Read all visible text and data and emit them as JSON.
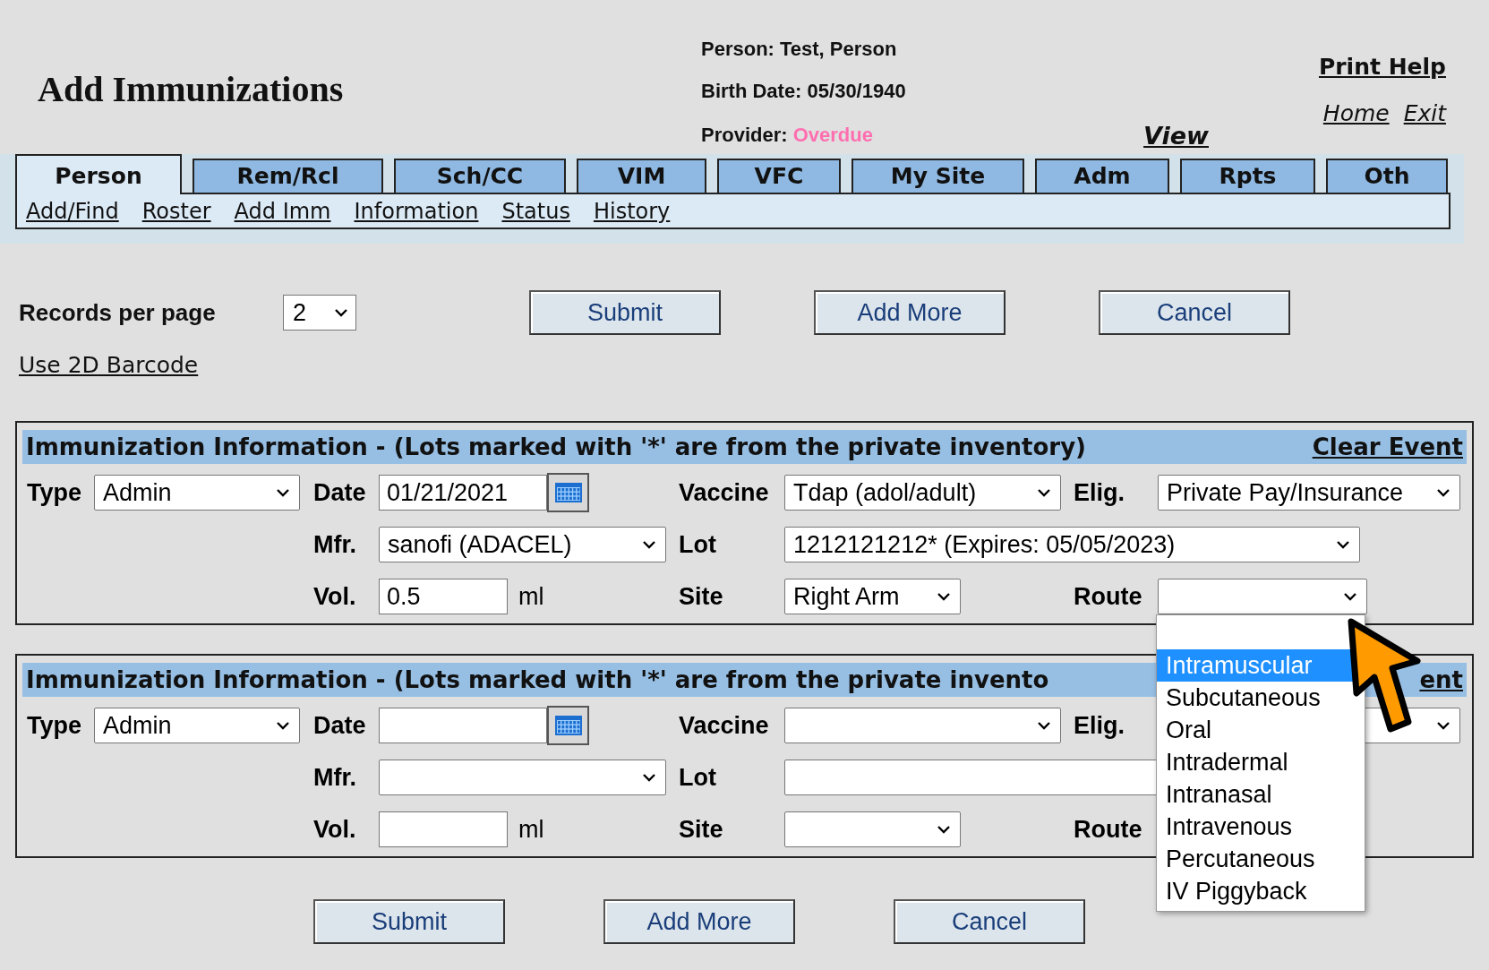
{
  "page_title": "Add Immunizations",
  "person_info": {
    "person": "Person: Test, Person",
    "birth_date": "Birth Date: 05/30/1940",
    "provider_label": "Provider:",
    "provider_value": "Overdue",
    "view_link": "View"
  },
  "top_links": {
    "print_help": "Print Help",
    "home": "Home",
    "exit": "Exit"
  },
  "tabs": [
    {
      "label": "Person",
      "selected": true
    },
    {
      "label": "Rem/Rcl",
      "selected": false
    },
    {
      "label": "Sch/CC",
      "selected": false
    },
    {
      "label": "VIM",
      "selected": false
    },
    {
      "label": "VFC",
      "selected": false
    },
    {
      "label": "My Site",
      "selected": false
    },
    {
      "label": "Adm",
      "selected": false
    },
    {
      "label": "Rpts",
      "selected": false
    },
    {
      "label": "Oth",
      "selected": false
    }
  ],
  "sub_links": [
    "Add/Find",
    "Roster",
    "Add Imm",
    "Information",
    "Status",
    "History"
  ],
  "records_per_page": {
    "label": "Records per page",
    "value": "2"
  },
  "top_buttons": [
    "Submit",
    "Add More",
    "Cancel"
  ],
  "barcode_link": "Use 2D Barcode",
  "panels": [
    {
      "title": "Immunization Information - (Lots marked with '*' are from the private inventory)",
      "clear_event": "Clear Event",
      "labels": {
        "type": "Type",
        "date": "Date",
        "vaccine": "Vaccine",
        "elig": "Elig.",
        "mfr": "Mfr.",
        "lot": "Lot",
        "vol": "Vol.",
        "unit": "ml",
        "site": "Site",
        "route": "Route"
      },
      "values": {
        "type": "Admin",
        "date": "01/21/2021",
        "vaccine": "Tdap (adol/adult)",
        "elig": "Private Pay/Insurance",
        "mfr": "sanofi (ADACEL)",
        "lot": "1212121212* (Expires: 05/05/2023)",
        "vol": "0.5",
        "site": "Right Arm"
      }
    },
    {
      "title": "Immunization Information - (Lots marked with '*' are from the private invento",
      "clear_event": "ent",
      "labels": {
        "type": "Type",
        "date": "Date",
        "vaccine": "Vaccine",
        "elig": "Elig.",
        "mfr": "Mfr.",
        "lot": "Lot",
        "vol": "Vol.",
        "unit": "ml",
        "site": "Site",
        "route": "Route"
      },
      "values": {
        "type": "Admin"
      }
    }
  ],
  "route_dropdown": {
    "options": [
      {
        "label": "Intramuscular",
        "selected": true
      },
      {
        "label": "Subcutaneous",
        "selected": false
      },
      {
        "label": "Oral",
        "selected": false
      },
      {
        "label": "Intradermal",
        "selected": false
      },
      {
        "label": "Intranasal",
        "selected": false
      },
      {
        "label": "Intravenous",
        "selected": false
      },
      {
        "label": "Percutaneous",
        "selected": false
      },
      {
        "label": "IV Piggyback",
        "selected": false
      }
    ]
  },
  "bottom_buttons": [
    "Submit",
    "Add More",
    "Cancel"
  ]
}
